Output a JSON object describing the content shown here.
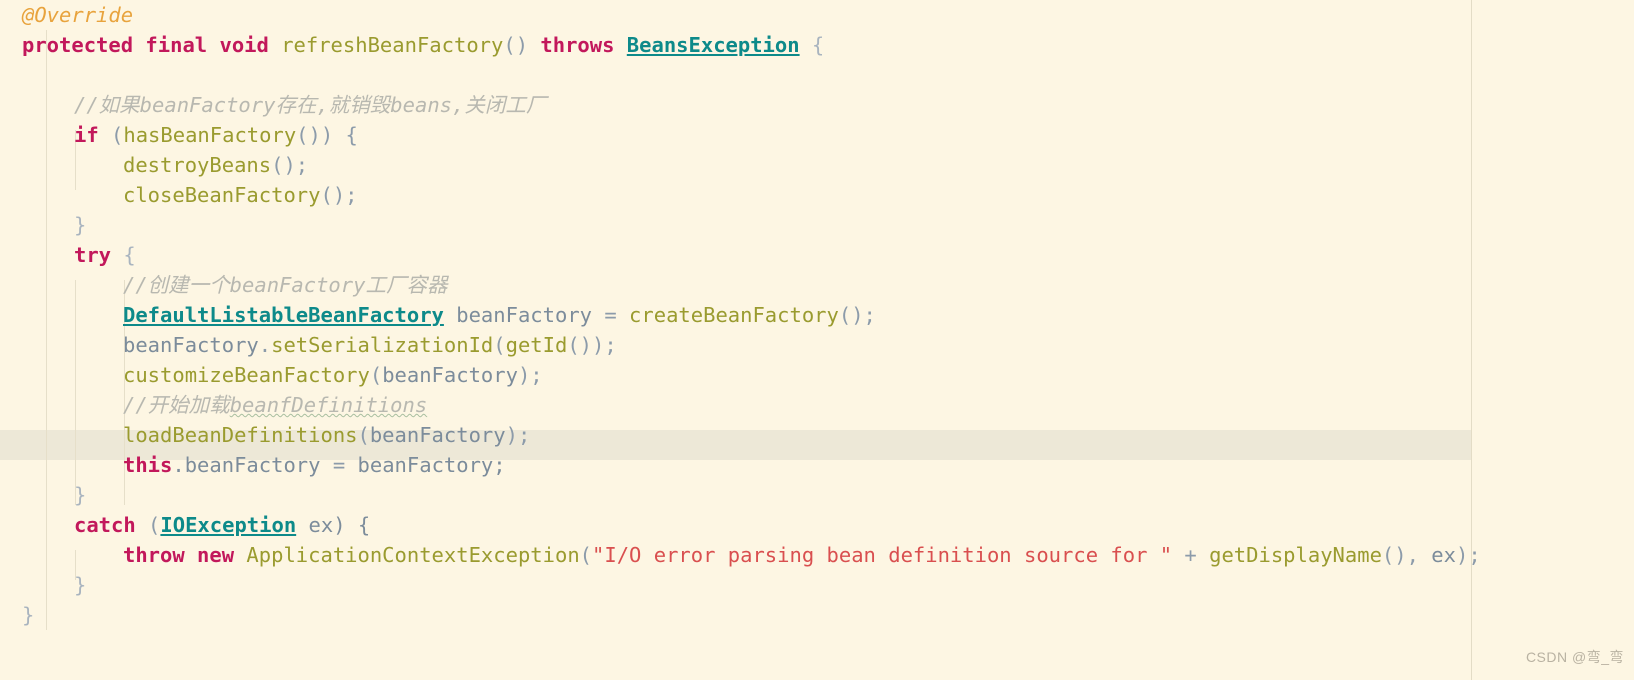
{
  "editor": {
    "background_color": "#FDF6E3",
    "highlight_color": "#EDE8D7",
    "margin_line_color": "#E3DCC6",
    "colors": {
      "keyword": "#C2185B",
      "annotation": "#E8A33D",
      "class_name": "#0D8A8A",
      "method_call": "#9A9B2F",
      "identifier": "#7C8C9B",
      "string": "#D94F4F",
      "comment": "#B8B8B0"
    }
  },
  "code": {
    "line_01": {
      "t1": "@Override"
    },
    "line_02": {
      "t1": "protected final void ",
      "t2": "refreshBeanFactory",
      "t3": "() ",
      "t4": "throws ",
      "t5": "BeansException",
      "t6": " {"
    },
    "line_03": {
      "t1": ""
    },
    "line_04": {
      "t1": "//如果beanFactory存在,就销毁beans,关闭工厂"
    },
    "line_05": {
      "t1": "if",
      "t2": " (",
      "t3": "hasBeanFactory",
      "t4": "()) {"
    },
    "line_06": {
      "t1": "destroyBeans",
      "t2": "();"
    },
    "line_07": {
      "t1": "closeBeanFactory",
      "t2": "();"
    },
    "line_08": {
      "t1": "}"
    },
    "line_09": {
      "t1": "try",
      "t2": " {"
    },
    "line_10": {
      "t1": "//创建一个beanFactory工厂容器"
    },
    "line_11": {
      "t1": "DefaultListableBeanFactory",
      "t2": " beanFactory ",
      "t3": "= ",
      "t4": "createBeanFactory",
      "t5": "();"
    },
    "line_12": {
      "t1": "beanFactory",
      "t2": ".",
      "t3": "setSerializationId",
      "t4": "(",
      "t5": "getId",
      "t6": "());"
    },
    "line_13": {
      "t1": "customizeBeanFactory",
      "t2": "(",
      "t3": "beanFactory",
      "t4": ");"
    },
    "line_14": {
      "t1": "//开始加载",
      "t2": "beanfDefinitions"
    },
    "line_15": {
      "t1": "loadBeanDefinitions",
      "t2": "(",
      "t3": "beanFactory",
      "t4": ");"
    },
    "line_16": {
      "t1": "this",
      "t2": ".beanFactory ",
      "t3": "= ",
      "t4": "beanFactory;"
    },
    "line_17": {
      "t1": "}"
    },
    "line_18": {
      "t1": "catch",
      "t2": " (",
      "t3": "IOException",
      "t4": " ex) {"
    },
    "line_19": {
      "t1": "throw new ",
      "t2": "ApplicationContextException",
      "t3": "(",
      "t4": "\"I/O error parsing bean definition source for \"",
      "t5": " + ",
      "t6": "getDisplayName",
      "t7": "(), ",
      "t8": "ex",
      "t9": ");"
    },
    "line_20": {
      "t1": "}"
    },
    "line_21": {
      "t1": "}"
    }
  },
  "watermark": {
    "text": "CSDN @弯_弯"
  }
}
